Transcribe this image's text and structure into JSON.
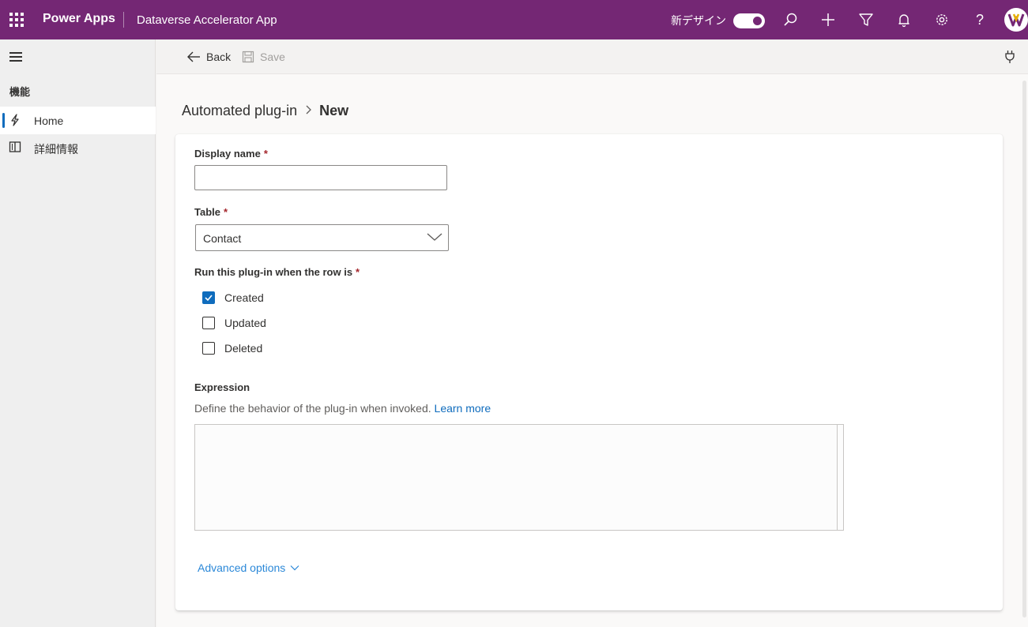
{
  "topbar": {
    "brand": "Power Apps",
    "app_name": "Dataverse Accelerator App",
    "new_design_label": "新デザイン",
    "new_design_on": true,
    "icons": [
      "waffle-icon",
      "search-icon",
      "add-icon",
      "filter-icon",
      "notification-icon",
      "settings-icon",
      "help-icon"
    ],
    "accent_color": "#742774"
  },
  "sidebar": {
    "section_title": "機能",
    "items": [
      {
        "label": "Home",
        "icon": "bolt-icon",
        "active": true
      },
      {
        "label": "詳細情報",
        "icon": "book-icon",
        "active": false
      }
    ]
  },
  "command_bar": {
    "back_label": "Back",
    "save_label": "Save",
    "save_enabled": false
  },
  "breadcrumb": {
    "parent": "Automated plug-in",
    "current": "New"
  },
  "form": {
    "display_name": {
      "label": "Display name",
      "required_mark": "*",
      "value": ""
    },
    "table": {
      "label": "Table",
      "required_mark": "*",
      "value": "Contact"
    },
    "run_when": {
      "label": "Run this plug-in when the row is",
      "required_mark": "*",
      "options": [
        {
          "label": "Created",
          "checked": true
        },
        {
          "label": "Updated",
          "checked": false
        },
        {
          "label": "Deleted",
          "checked": false
        }
      ]
    },
    "expression": {
      "label": "Expression",
      "hint": "Define the behavior of the plug-in when invoked.",
      "learn_more": "Learn more",
      "value": ""
    },
    "advanced_options": "Advanced options"
  }
}
